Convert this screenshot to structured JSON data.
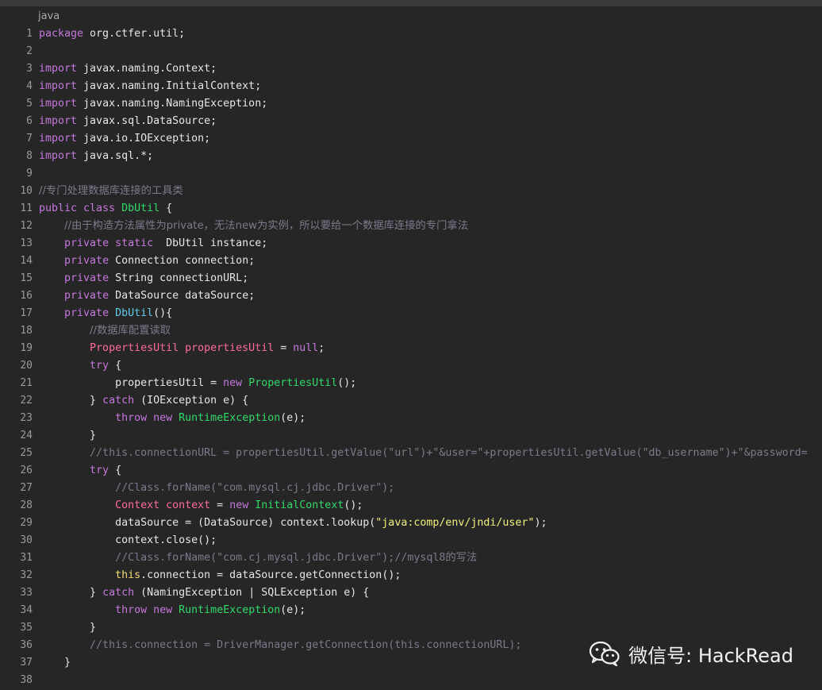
{
  "editor": {
    "language_label": "java",
    "lines": [
      {
        "n": "1",
        "t": [
          [
            "kw",
            "package"
          ],
          [
            "",
            "org.ctfer.util;"
          ]
        ]
      },
      {
        "n": "2",
        "t": []
      },
      {
        "n": "3",
        "t": [
          [
            "kw",
            "import"
          ],
          [
            "",
            "javax.naming.Context;"
          ]
        ]
      },
      {
        "n": "4",
        "t": [
          [
            "kw",
            "import"
          ],
          [
            "",
            "javax.naming.InitialContext;"
          ]
        ]
      },
      {
        "n": "5",
        "t": [
          [
            "kw",
            "import"
          ],
          [
            "",
            "javax.naming.NamingException;"
          ]
        ]
      },
      {
        "n": "6",
        "t": [
          [
            "kw",
            "import"
          ],
          [
            "",
            "javax.sql.DataSource;"
          ]
        ]
      },
      {
        "n": "7",
        "t": [
          [
            "kw",
            "import"
          ],
          [
            "",
            "java.io.IOException;"
          ]
        ]
      },
      {
        "n": "8",
        "t": [
          [
            "kw",
            "import"
          ],
          [
            "",
            "java.sql.*;"
          ]
        ]
      },
      {
        "n": "9",
        "t": []
      },
      {
        "n": "10",
        "t": [
          [
            "cmt-cn",
            "//专门处理数据库连接的工具类"
          ]
        ]
      },
      {
        "n": "11",
        "t": [
          [
            "kw",
            "public class "
          ],
          [
            "cls",
            "DbUtil"
          ],
          [
            "",
            " {"
          ]
        ]
      },
      {
        "n": "12",
        "t": [
          [
            "",
            "    "
          ],
          [
            "cmt-cn",
            "//由于构造方法属性为private，无法new为实例，所以要给一个数据库连接的专门拿法"
          ]
        ]
      },
      {
        "n": "13",
        "t": [
          [
            "",
            "    "
          ],
          [
            "kw",
            "private static"
          ],
          [
            "",
            "  DbUtil instance;"
          ]
        ]
      },
      {
        "n": "14",
        "t": [
          [
            "",
            "    "
          ],
          [
            "kw",
            "private"
          ],
          [
            "",
            " Connection connection;"
          ]
        ]
      },
      {
        "n": "15",
        "t": [
          [
            "",
            "    "
          ],
          [
            "kw",
            "private"
          ],
          [
            "",
            " String connectionURL;"
          ]
        ]
      },
      {
        "n": "16",
        "t": [
          [
            "",
            "    "
          ],
          [
            "kw",
            "private"
          ],
          [
            "",
            " DataSource dataSource;"
          ]
        ]
      },
      {
        "n": "17",
        "t": [
          [
            "",
            "    "
          ],
          [
            "kw",
            "private"
          ],
          [
            "",
            " "
          ],
          [
            "fn",
            "DbUtil"
          ],
          [
            "",
            "(){"
          ]
        ]
      },
      {
        "n": "18",
        "t": [
          [
            "",
            "        "
          ],
          [
            "cmt-cn",
            "//数据库配置读取"
          ]
        ]
      },
      {
        "n": "19",
        "t": [
          [
            "",
            "        "
          ],
          [
            "typ",
            "PropertiesUtil propertiesUtil"
          ],
          [
            "",
            " = "
          ],
          [
            "kw",
            "null"
          ],
          [
            "",
            ";"
          ]
        ]
      },
      {
        "n": "20",
        "t": [
          [
            "",
            "        "
          ],
          [
            "kw",
            "try"
          ],
          [
            "",
            " {"
          ]
        ]
      },
      {
        "n": "21",
        "t": [
          [
            "",
            "            propertiesUtil = "
          ],
          [
            "kw",
            "new"
          ],
          [
            "",
            " "
          ],
          [
            "cls",
            "PropertiesUtil"
          ],
          [
            "",
            "();"
          ]
        ]
      },
      {
        "n": "22",
        "t": [
          [
            "",
            "        } "
          ],
          [
            "kw",
            "catch"
          ],
          [
            "",
            " (IOException e) {"
          ]
        ]
      },
      {
        "n": "23",
        "t": [
          [
            "",
            "            "
          ],
          [
            "kw",
            "throw new"
          ],
          [
            "",
            " "
          ],
          [
            "cls",
            "RuntimeException"
          ],
          [
            "",
            "(e);"
          ]
        ]
      },
      {
        "n": "24",
        "t": [
          [
            "",
            "        }"
          ]
        ]
      },
      {
        "n": "25",
        "t": [
          [
            "",
            "        "
          ],
          [
            "cmt",
            "//this.connectionURL = propertiesUtil.getValue(\"url\")+\"&user=\"+propertiesUtil.getValue(\"db_username\")+\"&password="
          ]
        ]
      },
      {
        "n": "26",
        "t": [
          [
            "",
            "        "
          ],
          [
            "kw",
            "try"
          ],
          [
            "",
            " {"
          ]
        ]
      },
      {
        "n": "27",
        "t": [
          [
            "",
            "            "
          ],
          [
            "cmt",
            "//Class.forName(\"com.mysql.cj.jdbc.Driver\");"
          ]
        ]
      },
      {
        "n": "28",
        "t": [
          [
            "",
            "            "
          ],
          [
            "typ",
            "Context context"
          ],
          [
            "",
            " = "
          ],
          [
            "kw",
            "new"
          ],
          [
            "",
            " "
          ],
          [
            "cls",
            "InitialContext"
          ],
          [
            "",
            "();"
          ]
        ]
      },
      {
        "n": "29",
        "t": [
          [
            "",
            "            dataSource = (DataSource) context.lookup("
          ],
          [
            "str",
            "\"java:comp/env/jndi/user\""
          ],
          [
            "",
            ");"
          ]
        ]
      },
      {
        "n": "30",
        "t": [
          [
            "",
            "            context.close();"
          ]
        ]
      },
      {
        "n": "31",
        "t": [
          [
            "",
            "            "
          ],
          [
            "cmt",
            "//Class.forName(\"com.cj.mysql.jdbc.Driver\");//mysql8的写法"
          ]
        ]
      },
      {
        "n": "32",
        "t": [
          [
            "",
            "            "
          ],
          [
            "this",
            "this"
          ],
          [
            "",
            ".connection = dataSource.getConnection();"
          ]
        ]
      },
      {
        "n": "33",
        "t": [
          [
            "",
            "        } "
          ],
          [
            "kw",
            "catch"
          ],
          [
            "",
            " (NamingException | SQLException e) {"
          ]
        ]
      },
      {
        "n": "34",
        "t": [
          [
            "",
            "            "
          ],
          [
            "kw",
            "throw new"
          ],
          [
            "",
            " "
          ],
          [
            "cls",
            "RuntimeException"
          ],
          [
            "",
            "(e);"
          ]
        ]
      },
      {
        "n": "35",
        "t": [
          [
            "",
            "        }"
          ]
        ]
      },
      {
        "n": "36",
        "t": [
          [
            "",
            "        "
          ],
          [
            "cmt",
            "//this.connection = DriverManager.getConnection(this.connectionURL);"
          ]
        ]
      },
      {
        "n": "37",
        "t": [
          [
            "",
            "    }"
          ]
        ]
      },
      {
        "n": "38",
        "t": []
      }
    ]
  },
  "watermark": {
    "text": "微信号: HackRead",
    "icon": "wechat-icon"
  },
  "colors": {
    "keyword": "#c678dd",
    "class": "#2fd96a",
    "type": "#ff6b9a",
    "string": "#f3f07a",
    "comment": "#7a7a8c",
    "background": "#262626"
  }
}
